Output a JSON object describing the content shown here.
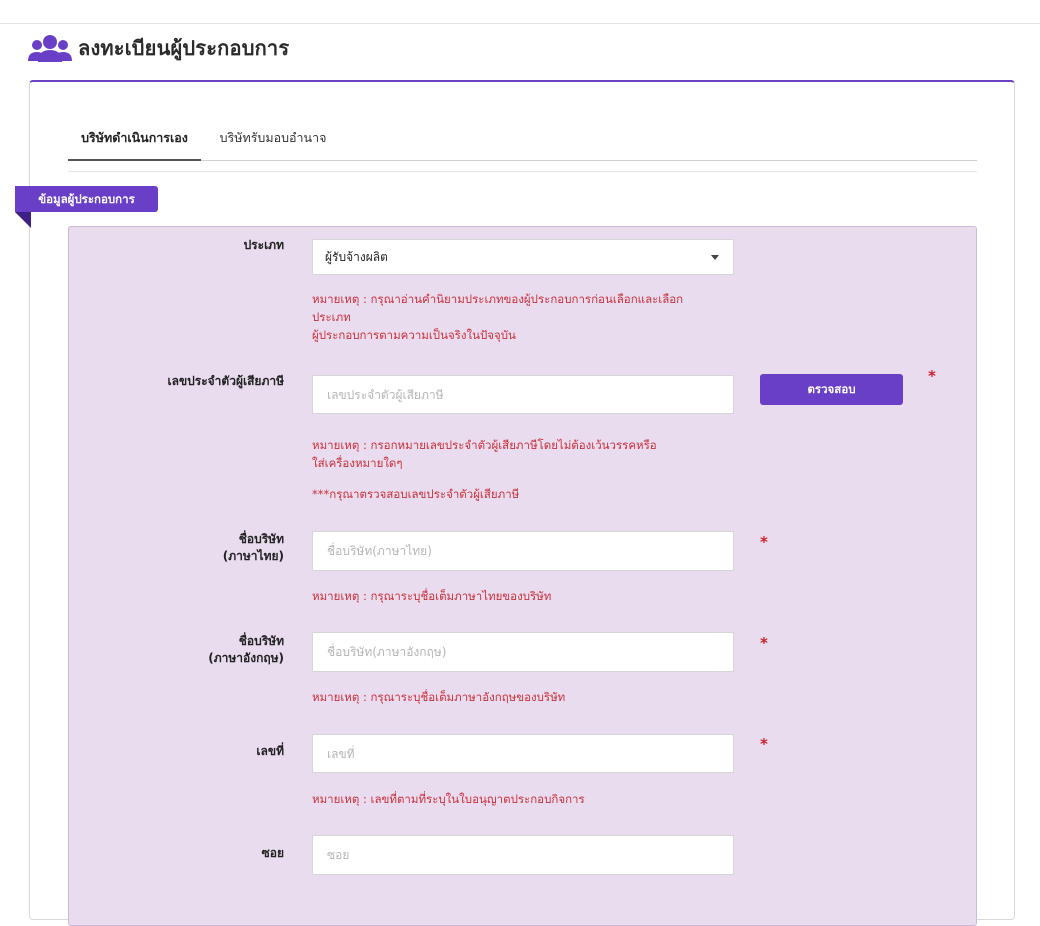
{
  "header": {
    "title": "ลงทะเบียนผู้ประกอบการ"
  },
  "tabs": [
    {
      "label": "บริษัทดำเนินการเอง"
    },
    {
      "label": "บริษัทรับมอบอำนาจ"
    }
  ],
  "section": {
    "ribbon": "ข้อมูลผู้ประกอบการ"
  },
  "form": {
    "type": {
      "label": "ประเภท",
      "value": "ผู้รับจ้างผลิต",
      "note_line1": "หมายเหตุ : กรุณาอ่านคำนิยามประเภทของผู้ประกอบการก่อนเลือกและเลือก",
      "note_line2": "ประเภท",
      "note_line3": "ผู้ประกอบการตามความเป็นจริงในปัจจุบัน"
    },
    "tax_id": {
      "label": "เลขประจำตัวผู้เสียภาษี",
      "placeholder": "เลขประจำตัวผู้เสียภาษี",
      "button": "ตรวจสอบ",
      "required": "*",
      "note_line1": "หมายเหตุ : กรอกหมายเลขประจำตัวผู้เสียภาษีโดยไม่ต้องเว้นวรรคหรือ",
      "note_line2": "ใส่เครื่องหมายใดๆ",
      "warning": "***กรุณาตรวจสอบเลขประจำตัวผู้เสียภาษี"
    },
    "company_th": {
      "label_line1": "ชื่อบริษัท",
      "label_line2": "(ภาษาไทย)",
      "placeholder": "ชื่อบริษัท(ภาษาไทย)",
      "required": "*",
      "note": "หมายเหตุ : กรุณาระบุชื่อเต็มภาษาไทยของบริษัท"
    },
    "company_en": {
      "label_line1": "ชื่อบริษัท",
      "label_line2": "(ภาษาอังกฤษ)",
      "placeholder": "ชื่อบริษัท(ภาษาอังกฤษ)",
      "required": "*",
      "note": "หมายเหตุ : กรุณาระบุชื่อเต็มภาษาอังกฤษของบริษัท"
    },
    "house_no": {
      "label": "เลขที่",
      "placeholder": "เลขที่",
      "required": "*",
      "note": "หมายเหตุ : เลขที่ตามที่ระบุในใบอนุญาตประกอบกิจการ"
    },
    "soi": {
      "label": "ซอย",
      "placeholder": "ซอย"
    }
  },
  "colors": {
    "accent": "#6a3fc8",
    "panel_bg": "#eadcef",
    "note": "#c9303a",
    "required": "#d11f2a"
  },
  "icons": {
    "header": "users-group-icon"
  }
}
